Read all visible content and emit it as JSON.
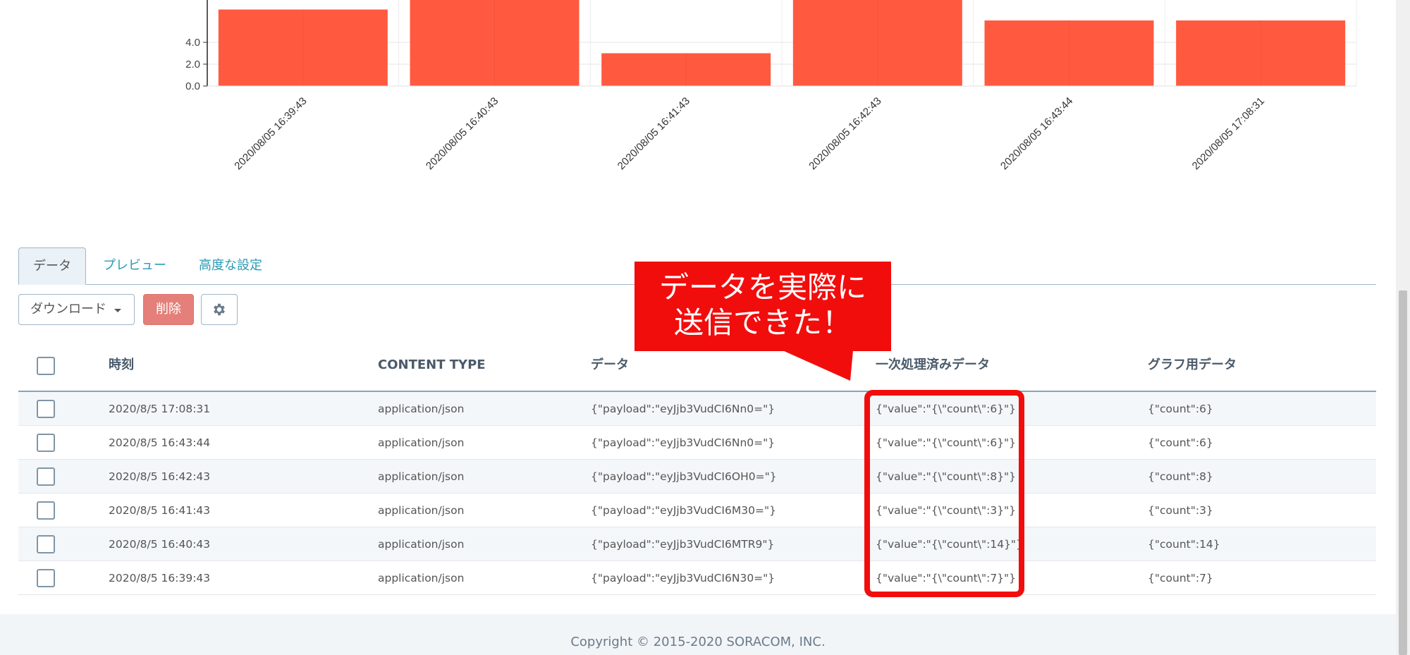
{
  "chart_data": {
    "type": "bar",
    "categories": [
      "2020/08/05 16:39:43",
      "2020/08/05 16:40:43",
      "2020/08/05 16:41:43",
      "2020/08/05 16:42:43",
      "2020/08/05 16:43:44",
      "2020/08/05 17:08:31"
    ],
    "values": [
      7,
      14,
      3,
      8,
      6,
      6
    ],
    "yticks": [
      "0.0",
      "2.0",
      "4.0"
    ],
    "ylim": [
      0,
      14
    ],
    "bar_color": "#ff5a40",
    "grid": true
  },
  "tabs": [
    {
      "label": "データ"
    },
    {
      "label": "プレビュー"
    },
    {
      "label": "高度な設定"
    }
  ],
  "toolbar": {
    "download_label": "ダウンロード",
    "delete_label": "削除",
    "settings_icon": "gear-icon"
  },
  "table": {
    "headers": {
      "time": "時刻",
      "content_type": "CONTENT TYPE",
      "data": "データ",
      "processed": "一次処理済みデータ",
      "graph": "グラフ用データ"
    },
    "rows": [
      {
        "time": "2020/8/5 17:08:31",
        "content_type": "application/json",
        "data": "{\"payload\":\"eyJjb3VudCI6Nn0=\"}",
        "processed": "{\"value\":\"{\\\"count\\\":6}\"}",
        "graph": "{\"count\":6}"
      },
      {
        "time": "2020/8/5 16:43:44",
        "content_type": "application/json",
        "data": "{\"payload\":\"eyJjb3VudCI6Nn0=\"}",
        "processed": "{\"value\":\"{\\\"count\\\":6}\"}",
        "graph": "{\"count\":6}"
      },
      {
        "time": "2020/8/5 16:42:43",
        "content_type": "application/json",
        "data": "{\"payload\":\"eyJjb3VudCI6OH0=\"}",
        "processed": "{\"value\":\"{\\\"count\\\":8}\"}",
        "graph": "{\"count\":8}"
      },
      {
        "time": "2020/8/5 16:41:43",
        "content_type": "application/json",
        "data": "{\"payload\":\"eyJjb3VudCI6M30=\"}",
        "processed": "{\"value\":\"{\\\"count\\\":3}\"}",
        "graph": "{\"count\":3}"
      },
      {
        "time": "2020/8/5 16:40:43",
        "content_type": "application/json",
        "data": "{\"payload\":\"eyJjb3VudCI6MTR9\"}",
        "processed": "{\"value\":\"{\\\"count\\\":14}\"}",
        "graph": "{\"count\":14}"
      },
      {
        "time": "2020/8/5 16:39:43",
        "content_type": "application/json",
        "data": "{\"payload\":\"eyJjb3VudCI6N30=\"}",
        "processed": "{\"value\":\"{\\\"count\\\":7}\"}",
        "graph": "{\"count\":7}"
      }
    ]
  },
  "callout": {
    "line1": "データを実際に",
    "line2": "送信できた！",
    "color": "#f20d0d"
  },
  "footer": {
    "copyright": "Copyright © 2015-2020 SORACOM, INC."
  }
}
